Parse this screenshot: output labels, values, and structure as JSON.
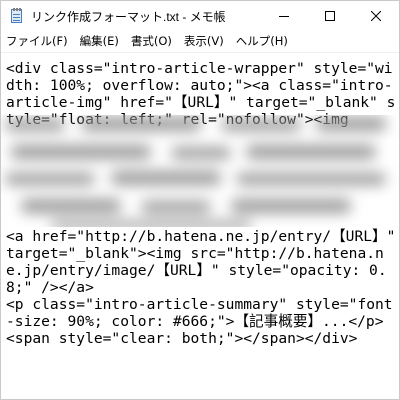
{
  "window": {
    "title": "リンク作成フォーマット.txt - メモ帳",
    "app_icon": "notepad-icon",
    "controls": {
      "minimize": "minimize-icon",
      "maximize": "maximize-icon",
      "close": "close-icon"
    }
  },
  "menubar": {
    "items": [
      {
        "label": "ファイル(F)"
      },
      {
        "label": "編集(E)"
      },
      {
        "label": "書式(O)"
      },
      {
        "label": "表示(V)"
      },
      {
        "label": "ヘルプ(H)"
      }
    ]
  },
  "editor": {
    "content_top": "<div class=\"intro-article-wrapper\" style=\"width: 100%; overflow: auto;\"><a class=\"intro-article-img\" href=\"【URL】\" target=\"_blank\" style=\"float: left;\" rel=\"nofollow\"><img",
    "content_bottom": "<a href=\"http://b.hatena.ne.jp/entry/【URL】\" target=\"_blank\"><img src=\"http://b.hatena.ne.jp/entry/image/【URL】\" style=\"opacity: 0.8;\" /></a>\n<p class=\"intro-article-summary\" style=\"font-size: 90%; color: #666;\">【記事概要】...</p>\n<span style=\"clear: both;\"></span></div>"
  }
}
